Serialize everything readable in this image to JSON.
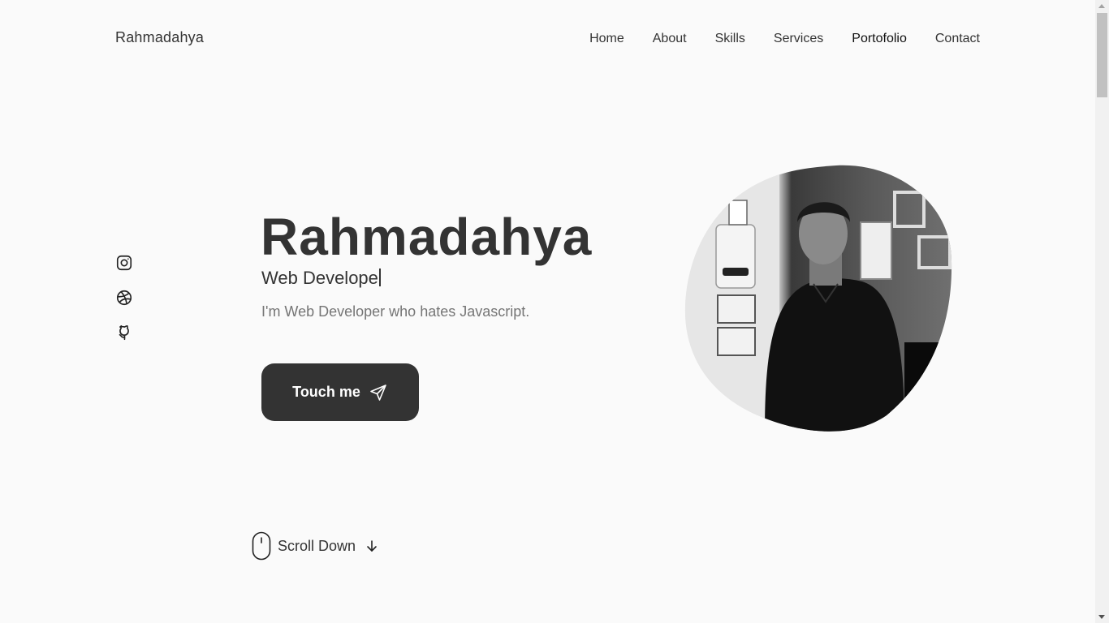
{
  "header": {
    "logo": "Rahmadahya",
    "nav": [
      {
        "label": "Home"
      },
      {
        "label": "About"
      },
      {
        "label": "Skills"
      },
      {
        "label": "Services"
      },
      {
        "label": "Portofolio"
      },
      {
        "label": "Contact"
      }
    ]
  },
  "socials": [
    {
      "icon": "instagram-icon"
    },
    {
      "icon": "dribbble-icon"
    },
    {
      "icon": "github-icon"
    }
  ],
  "hero": {
    "title": "Rahmadahya",
    "subtitle": "Web Develope",
    "description": "I'm Web Developer who hates Javascript.",
    "button_label": "Touch me",
    "button_icon": "send-icon",
    "photo": "profile-photo"
  },
  "scroll": {
    "label": "Scroll Down",
    "mouse_icon": "mouse-icon",
    "arrow_icon": "arrow-down-icon"
  },
  "colors": {
    "background": "#fafafa",
    "text": "#333333",
    "muted": "#757575",
    "button": "#333333"
  }
}
